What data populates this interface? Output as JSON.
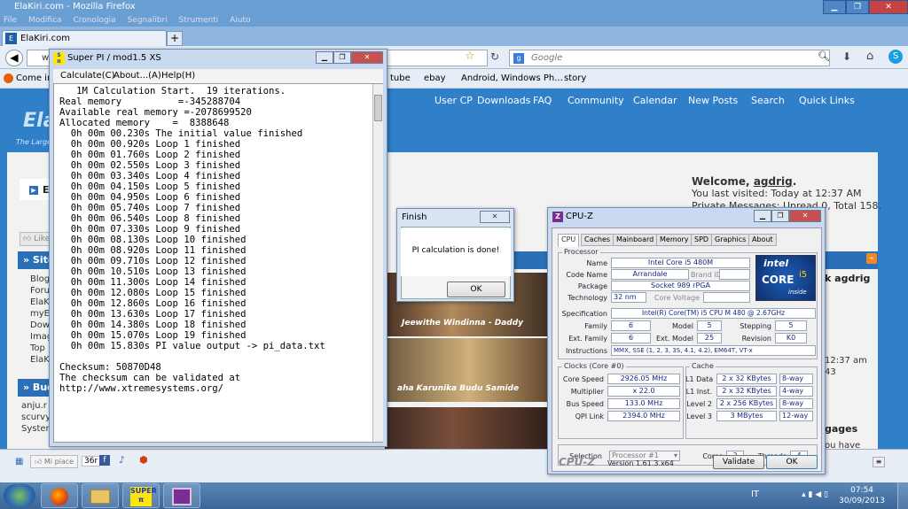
{
  "firefox": {
    "window_title": "ElaKiri.com - Mozilla Firefox",
    "menu": [
      "File",
      "Modifica",
      "Cronologia",
      "Segnalibri",
      "Strumenti",
      "Aiuto"
    ],
    "tab_title": "ElaKiri.com",
    "url": "ww",
    "search_placeholder": "Google",
    "bookmarks": [
      "Come iniz",
      "tube",
      "ebay",
      "Android, Windows Ph...",
      "story"
    ]
  },
  "site": {
    "nav": [
      "User CP",
      "Downloads",
      "FAQ",
      "Community",
      "Calendar",
      "New Posts",
      "Search",
      "Quick Links"
    ],
    "logo": "Ela",
    "tagline": "The Large",
    "welcome_label": "Welcome,",
    "welcome_user": "agdrig",
    "last_visited": "You last visited: Today at 12:37 AM",
    "private_messages": "Private Messages",
    "pm_detail": ": Unread 0, Total 158.",
    "like_label": "Like",
    "site_header": "» Site",
    "side_items": [
      "Blog",
      "Foru",
      "ElaK",
      "myE",
      "Dow",
      "Imag",
      "Top",
      "ElaK"
    ],
    "budd_header": "» Bud",
    "budd_items": [
      "anju.r",
      "scurvy",
      "Syster"
    ],
    "right_snip_1": "k agdrig",
    "right_snip_2": "12:37 am",
    "right_snip_3": "43",
    "right_snip_4": "gages",
    "right_snip_5": "ou have",
    "banner_1": "Jeewithe Windinna - Daddy",
    "banner_2": "aha Karunika Budu Samide",
    "mi_piace": "Mi piace",
    "like_count": "36r"
  },
  "superpi": {
    "title": "Super PI / mod1.5 XS",
    "menu": [
      "Calculate(C)",
      "About...(A)",
      "Help(H)"
    ],
    "lines": [
      "   1M Calculation Start.  19 iterations.",
      "Real memory          =-345288704",
      "Available real memory =-2078699520",
      "Allocated memory    =  8388648",
      "  0h 00m 00.230s The initial value finished",
      "  0h 00m 00.920s Loop 1 finished",
      "  0h 00m 01.760s Loop 2 finished",
      "  0h 00m 02.550s Loop 3 finished",
      "  0h 00m 03.340s Loop 4 finished",
      "  0h 00m 04.150s Loop 5 finished",
      "  0h 00m 04.950s Loop 6 finished",
      "  0h 00m 05.740s Loop 7 finished",
      "  0h 00m 06.540s Loop 8 finished",
      "  0h 00m 07.330s Loop 9 finished",
      "  0h 00m 08.130s Loop 10 finished",
      "  0h 00m 08.920s Loop 11 finished",
      "  0h 00m 09.710s Loop 12 finished",
      "  0h 00m 10.510s Loop 13 finished",
      "  0h 00m 11.300s Loop 14 finished",
      "  0h 00m 12.080s Loop 15 finished",
      "  0h 00m 12.860s Loop 16 finished",
      "  0h 00m 13.630s Loop 17 finished",
      "  0h 00m 14.380s Loop 18 finished",
      "  0h 00m 15.070s Loop 19 finished",
      "  0h 00m 15.830s PI value output -> pi_data.txt",
      "",
      "Checksum: 50870D48",
      "The checksum can be validated at",
      "http://www.xtremesystems.org/"
    ]
  },
  "finish": {
    "title": "Finish",
    "message": "PI calculation is done!",
    "ok": "OK"
  },
  "cpuz": {
    "title": "CPU-Z",
    "tabs": [
      "CPU",
      "Caches",
      "Mainboard",
      "Memory",
      "SPD",
      "Graphics",
      "About"
    ],
    "processor_group": "Processor",
    "name_label": "Name",
    "name": "Intel Core i5 480M",
    "codename_label": "Code Name",
    "codename": "Arrandale",
    "brandid_label": "Brand ID",
    "package_label": "Package",
    "package": "Socket 989 rPGA",
    "tech_label": "Technology",
    "tech": "32 nm",
    "corevolt_label": "Core Voltage",
    "spec_label": "Specification",
    "spec": "Intel(R) Core(TM) i5 CPU       M 480  @ 2.67GHz",
    "family_label": "Family",
    "family": "6",
    "model_label": "Model",
    "model": "5",
    "stepping_label": "Stepping",
    "stepping": "5",
    "extfamily_label": "Ext. Family",
    "extfamily": "6",
    "extmodel_label": "Ext. Model",
    "extmodel": "25",
    "revision_label": "Revision",
    "revision": "K0",
    "instr_label": "Instructions",
    "instr": "MMX, SSE (1, 2, 3, 3S, 4.1, 4.2), EM64T, VT-x",
    "logo_brand": "intel",
    "logo_core": "CORE",
    "logo_i": "i5",
    "logo_inside": "inside",
    "clocks_group": "Clocks (Core #0)",
    "corespeed_label": "Core Speed",
    "corespeed": "2926.05 MHz",
    "mult_label": "Multiplier",
    "mult": "x 22.0",
    "bus_label": "Bus Speed",
    "bus": "133.0 MHz",
    "qpi_label": "QPI Link",
    "qpi": "2394.0 MHz",
    "cache_group": "Cache",
    "l1d_label": "L1 Data",
    "l1d": "2 x 32 KBytes",
    "l1d_way": "8-way",
    "l1i_label": "L1 Inst.",
    "l1i": "2 x 32 KBytes",
    "l1i_way": "4-way",
    "l2_label": "Level 2",
    "l2": "2 x 256 KBytes",
    "l2_way": "8-way",
    "l3_label": "Level 3",
    "l3": "3 MBytes",
    "l3_way": "12-way",
    "selection_label": "Selection",
    "selection": "Processor #1",
    "cores_label": "Cores",
    "cores": "2",
    "threads_label": "Threads",
    "threads": "4",
    "brand_footer": "CPU-Z",
    "version": "Version 1.61.3.x64",
    "validate": "Validate",
    "ok": "OK"
  },
  "taskbar": {
    "lang": "IT",
    "time": "07:54",
    "date": "30/09/2013"
  }
}
